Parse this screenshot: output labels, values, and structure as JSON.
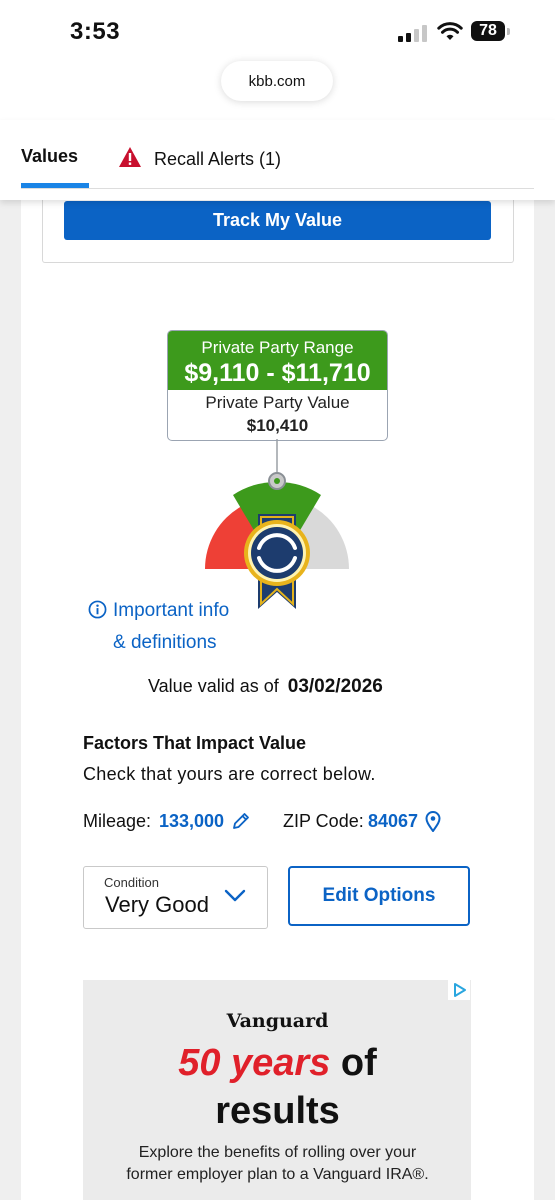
{
  "status_bar": {
    "time": "3:53",
    "battery": "78"
  },
  "browser": {
    "url": "kbb.com"
  },
  "tabs": {
    "values_label": "Values",
    "recall_label": "Recall Alerts (1)"
  },
  "track_button": "Track My Value",
  "private_party": {
    "range_label": "Private Party Range",
    "range_value": "$9,110 - $11,710",
    "value_label": "Private Party Value",
    "value": "$10,410"
  },
  "info": {
    "line1": "Important info",
    "line2": "& definitions"
  },
  "valid": {
    "label": "Value valid as of",
    "date": "03/02/2026"
  },
  "factors": {
    "title": "Factors That Impact Value",
    "subtitle": "Check that yours are correct below.",
    "mileage_label": "Mileage:",
    "mileage_value": "133,000",
    "zip_label": "ZIP Code:",
    "zip_value": "84067"
  },
  "condition": {
    "label": "Condition",
    "value": "Very Good"
  },
  "edit_button": "Edit Options",
  "ad": {
    "brand": "Vanguard",
    "headline_red": "50 years",
    "headline_black": "of",
    "headline2": "results",
    "body": "Explore the benefits of rolling over your former employer plan to a Vanguard IRA®."
  },
  "colors": {
    "accent_blue": "#0b63c5",
    "tab_underline": "#1a84e6",
    "range_green": "#3d9a1c",
    "gauge_red": "#ee4036",
    "gauge_gray": "#d9d9d9",
    "ad_red": "#e0202a"
  },
  "icons": [
    "signal-icon",
    "wifi-icon",
    "alert-triangle-icon",
    "info-icon",
    "pencil-icon",
    "map-pin-icon",
    "chevron-down-icon",
    "adchoices-icon",
    "kbb-ribbon-icon"
  ]
}
